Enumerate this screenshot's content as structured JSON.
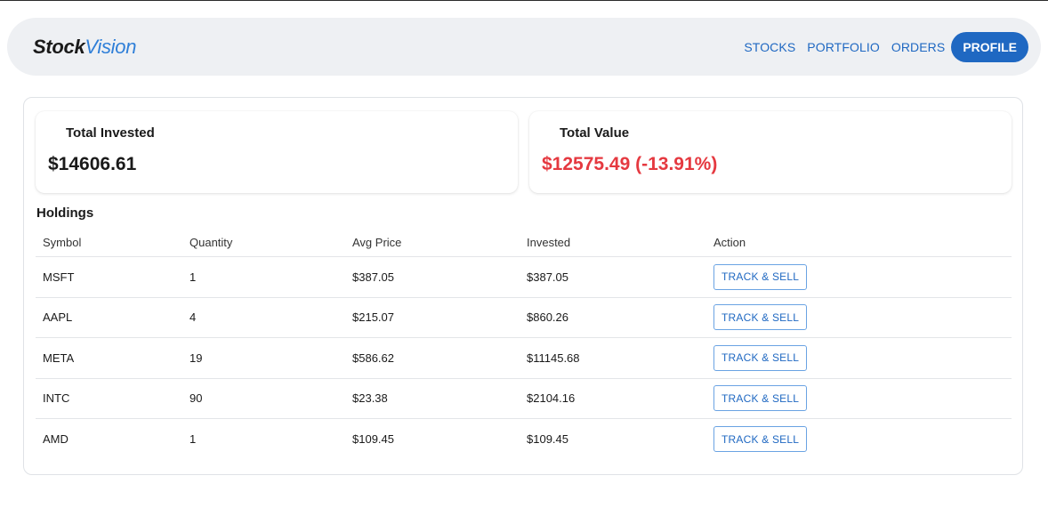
{
  "brand": {
    "part1": "Stock",
    "part2": "Vision"
  },
  "nav": {
    "links": [
      "STOCKS",
      "PORTFOLIO",
      "ORDERS"
    ],
    "profile": "PROFILE"
  },
  "summary": {
    "invested_label": "Total Invested",
    "invested_value": "$14606.61",
    "value_label": "Total Value",
    "value_value": "$12575.49 (-13.91%)",
    "value_color": "#e53940"
  },
  "holdings": {
    "title": "Holdings",
    "columns": [
      "Symbol",
      "Quantity",
      "Avg Price",
      "Invested",
      "Action"
    ],
    "rows": [
      {
        "symbol": "MSFT",
        "quantity": "1",
        "avg_price": "$387.05",
        "invested": "$387.05",
        "action": "TRACK & SELL"
      },
      {
        "symbol": "AAPL",
        "quantity": "4",
        "avg_price": "$215.07",
        "invested": "$860.26",
        "action": "TRACK & SELL"
      },
      {
        "symbol": "META",
        "quantity": "19",
        "avg_price": "$586.62",
        "invested": "$11145.68",
        "action": "TRACK & SELL"
      },
      {
        "symbol": "INTC",
        "quantity": "90",
        "avg_price": "$23.38",
        "invested": "$2104.16",
        "action": "TRACK & SELL"
      },
      {
        "symbol": "AMD",
        "quantity": "1",
        "avg_price": "$109.45",
        "invested": "$109.45",
        "action": "TRACK & SELL"
      }
    ]
  },
  "colors": {
    "accent": "#1f68c2",
    "brand_accent": "#2f7fd8",
    "negative": "#e53940"
  }
}
